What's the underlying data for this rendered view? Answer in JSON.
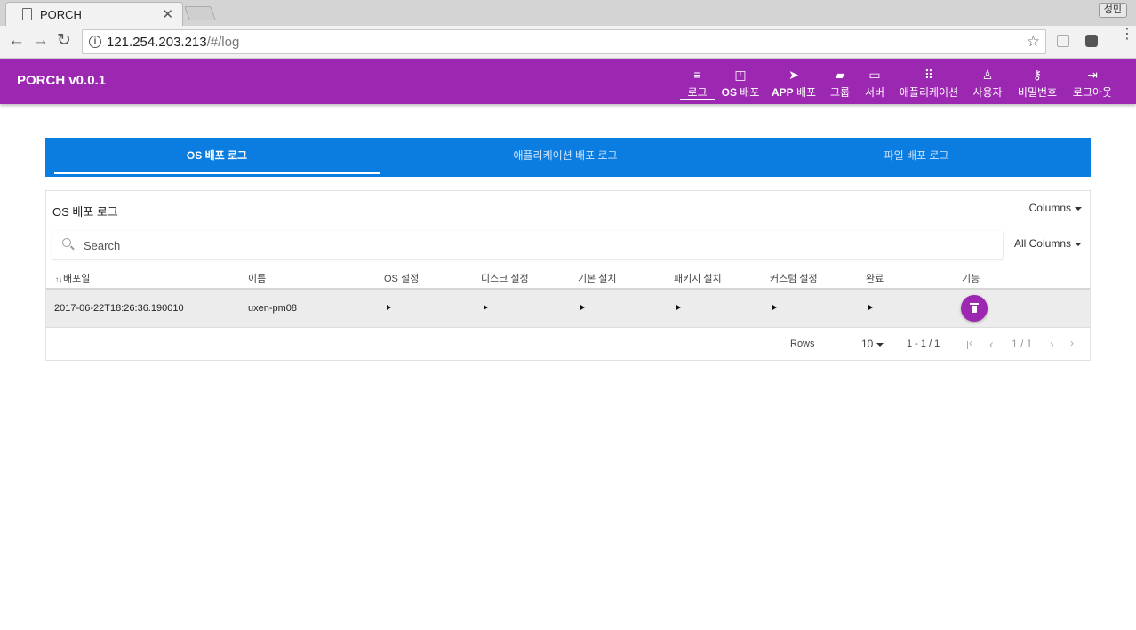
{
  "browser": {
    "tab_title": "PORCH",
    "tab_close": "✕",
    "profile_label": "성민",
    "url_host": "121.254.203.213",
    "url_path": "/#/log",
    "nav_back": "←",
    "nav_forward": "→",
    "nav_reload": "↻",
    "bookmark_star": "☆"
  },
  "app": {
    "title": "PORCH v0.0.1",
    "nav": [
      {
        "label": "로그",
        "icon": "list-icon",
        "glyph": "≡",
        "active": true
      },
      {
        "label_bold": "OS",
        "label": "배포",
        "icon": "cast-icon",
        "glyph": "◰"
      },
      {
        "label_bold": "APP",
        "label": "배포",
        "icon": "send-icon",
        "glyph": "➤"
      },
      {
        "label": "그룹",
        "icon": "folder-add-icon",
        "glyph": "▰"
      },
      {
        "label": "서버",
        "icon": "laptop-icon",
        "glyph": "▭"
      },
      {
        "label": "애플리케이션",
        "icon": "apps-grid-icon",
        "glyph": "⠿"
      },
      {
        "label": "사용자",
        "icon": "person-icon",
        "glyph": "♙"
      },
      {
        "label": "비밀번호",
        "icon": "key-icon",
        "glyph": "⚷"
      },
      {
        "label": "로그아웃",
        "icon": "logout-icon",
        "glyph": "⇥"
      }
    ]
  },
  "content_tabs": [
    {
      "label": "OS 배포 로그",
      "active": true
    },
    {
      "label": "애플리케이션 배포 로그",
      "active": false
    },
    {
      "label": "파일 배포 로그",
      "active": false
    }
  ],
  "table": {
    "title": "OS 배포 로그",
    "columns_button": "Columns",
    "search_placeholder": "Search",
    "search_scope": "All Columns",
    "sort_indicator": "↑↓",
    "headers": [
      "배포일",
      "이름",
      "OS 설정",
      "디스크 설정",
      "기본 설치",
      "패키지 설치",
      "커스텀 설정",
      "완료",
      "기능"
    ],
    "rows": [
      {
        "date": "2017-06-22T18:26:36.190010",
        "name": "uxen-pm08"
      }
    ],
    "footer": {
      "rows_label": "Rows",
      "rows_per_page": "10",
      "range": "1 - 1 / 1",
      "page": "1 / 1",
      "prev": "‹",
      "next": "›"
    }
  },
  "colors": {
    "appbar": "#9c27b0",
    "tabs_bar": "#0c7de0",
    "delete_button": "#9c27b0"
  }
}
